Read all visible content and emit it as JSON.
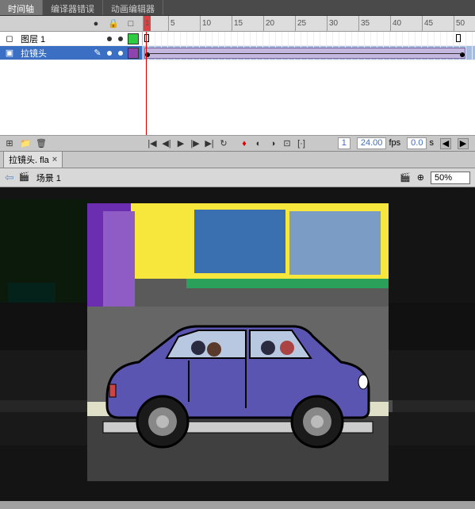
{
  "tabs": {
    "timeline": "时间轴",
    "compiler_errors": "编译器错误",
    "motion_editor": "动画编辑器"
  },
  "ruler": {
    "marks": [
      1,
      5,
      10,
      15,
      20,
      25,
      30,
      35,
      40,
      45,
      50
    ]
  },
  "layers": [
    {
      "name": "图层 1",
      "color": "#2ecc40",
      "selected": false,
      "locked": false
    },
    {
      "name": "拉镜头",
      "color": "#8e44ad",
      "selected": true,
      "locked": false,
      "editing": true
    }
  ],
  "playback": {
    "frame": "1",
    "fps": "24.00",
    "fps_label": "fps",
    "time": "0.0",
    "time_label": "s"
  },
  "doc_tab": {
    "name": "拉镜头. fla",
    "close": "×"
  },
  "edit_bar": {
    "back": "⇦",
    "scene": "场景 1",
    "zoom": "50%"
  },
  "icons": {
    "eye": "●",
    "lock": "🔒",
    "outline": "□",
    "new_layer": "⊞",
    "new_folder": "📁",
    "delete": "🗑",
    "rewind": "|◀",
    "step_back": "◀|",
    "play": "▶",
    "step_fwd": "|▶",
    "end": "▶|",
    "loop": "↻",
    "onion": "◐",
    "onion2": "◑",
    "onion3": "⊡",
    "bracket": "[·]",
    "left": "◀",
    "right": "▶",
    "clapper": "🎬",
    "symbol": "⊕",
    "layer_type": "◻",
    "camera": "▣",
    "pencil": "✎"
  }
}
